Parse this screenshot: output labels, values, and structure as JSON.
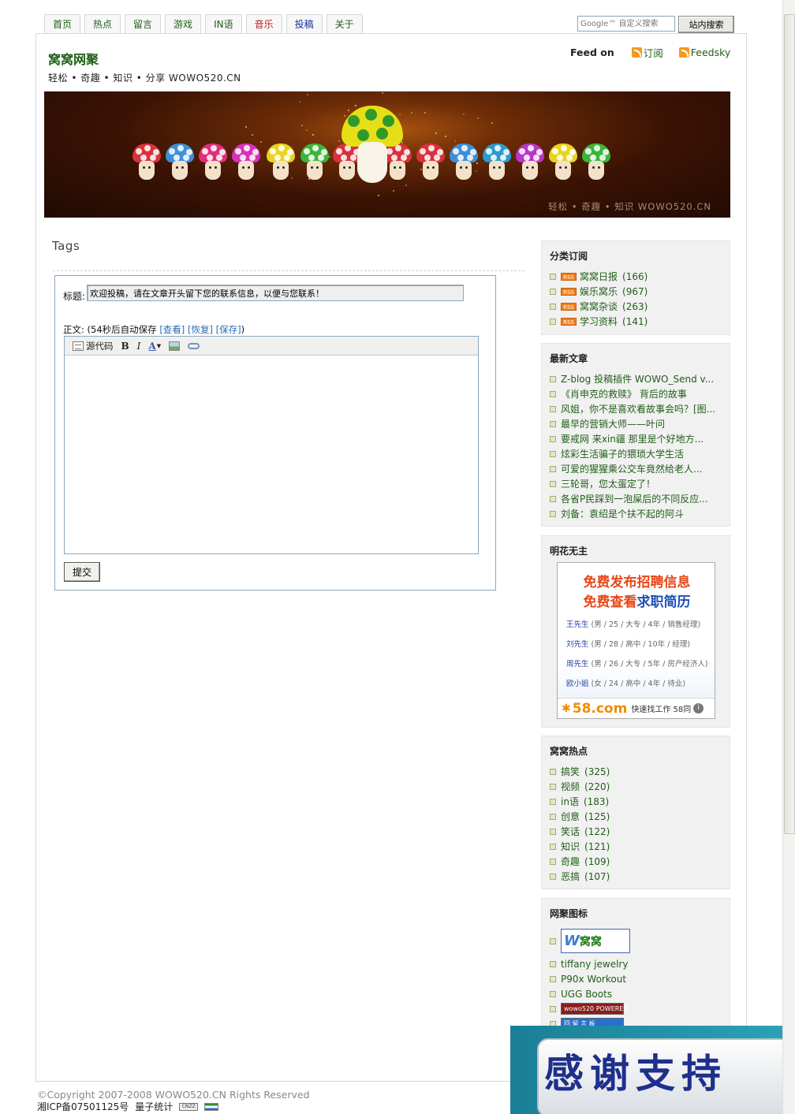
{
  "nav": {
    "tabs": [
      {
        "label": "首页",
        "style": "normal"
      },
      {
        "label": "热点",
        "style": "normal"
      },
      {
        "label": "留言",
        "style": "normal"
      },
      {
        "label": "游戏",
        "style": "normal"
      },
      {
        "label": "IN语",
        "style": "normal"
      },
      {
        "label": "音乐",
        "style": "red"
      },
      {
        "label": "投稿",
        "style": "blue"
      },
      {
        "label": "关于",
        "style": "normal"
      }
    ]
  },
  "search": {
    "placeholder": "Google™ 自定义搜索",
    "button_label": "站内搜索"
  },
  "header": {
    "title": "窝窝网聚",
    "subtitle": "轻松 • 奇趣 • 知识 • 分享 WOWO520.CN",
    "feed_label": "Feed on",
    "feed_links": [
      "订阅",
      "Feedsky"
    ]
  },
  "banner": {
    "text": "轻松 • 奇趣 • 知识 WOWO520.CN"
  },
  "main": {
    "heading": "Tags",
    "form": {
      "title_label": "标题:",
      "title_value": "欢迎投稿，请在文章开头留下您的联系信息，以便与您联系！",
      "body_label": "正文: (54秒后自动保存",
      "view_link": "[查看]",
      "restore_link": "[恢复]",
      "save_link": "[保存]",
      "close_paren": ")",
      "toolbar": {
        "source_label": "源代码",
        "bold": "B",
        "italic": "I",
        "font": "A"
      },
      "submit_label": "提交"
    }
  },
  "sidebar": {
    "category_feeds": {
      "title": "分类订阅",
      "badge": "RSS",
      "items": [
        {
          "label": "窝窝日报",
          "count": "(166)"
        },
        {
          "label": "娱乐窝乐",
          "count": "(967)"
        },
        {
          "label": "窝窝杂谈",
          "count": "(263)"
        },
        {
          "label": "学习资料",
          "count": "(141)"
        }
      ]
    },
    "latest_posts": {
      "title": "最新文章",
      "items": [
        "Z-blog 投稿插件 WOWO_Send v...",
        "《肖申克的救赎》 背后的故事",
        "风姐，你不是喜欢看故事会吗？[图...",
        "最早的营销大师——叶问",
        "要戒网 来xin疆 那里是个好地方...",
        "炫彩生活骗子的猥琐大学生活",
        "可爱的猩猩乘公交车竟然给老人...",
        "三轮哥，您太蛋定了！",
        "各省P民踩到一泡屎后的不同反应...",
        "刘备：袁绍是个扶不起的阿斗"
      ]
    },
    "ad_box": {
      "title": "明花无主",
      "line1": "免费发布招聘信息",
      "line2_pre": "免费查看",
      "line2_hl": "求职简历",
      "rows": [
        {
          "name": "王先生",
          "detail": "(男 / 25 / 大专 / 4年 / 销售经理)"
        },
        {
          "name": "刘先生",
          "detail": "(男 / 28 / 高中 / 10年 / 经理)"
        },
        {
          "name": "周先生",
          "detail": "(男 / 26 / 大专 / 5年 / 房产经济人)"
        },
        {
          "name": "欧小姐",
          "detail": "(女 / 24 / 高中 / 4年 / 待业)"
        }
      ],
      "logo": "58.com",
      "slogan": "快速找工作 58同",
      "info_icon": "i"
    },
    "hot_tags": {
      "title": "窝窝热点",
      "items": [
        {
          "label": "搞笑",
          "count": "(325)"
        },
        {
          "label": "视频",
          "count": "(220)"
        },
        {
          "label": "in语",
          "count": "(183)"
        },
        {
          "label": "创意",
          "count": "(125)"
        },
        {
          "label": "笑话",
          "count": "(122)"
        },
        {
          "label": "知识",
          "count": "(121)"
        },
        {
          "label": "奇趣",
          "count": "(109)"
        },
        {
          "label": "恶搞",
          "count": "(107)"
        }
      ]
    },
    "site_icons": {
      "title": "网聚图标",
      "wowo_badge_w": "W",
      "wowo_badge_text": "窝窝",
      "links": [
        "tiffany jewelry",
        "P90x Workout",
        "UGG Boots"
      ],
      "mini_badge_1": "wowo520 POWERED",
      "mini_badge_2": "回 留 言 板"
    }
  },
  "footer": {
    "copyright": "©Copyright 2007-2008 WOWO520.CN Rights Reserved",
    "icp": "湘ICP备07501125号",
    "stats": "量子统计",
    "cnzz": "CNZZ"
  },
  "overlay": {
    "text": "感谢支持"
  },
  "colors": {
    "link_green": "#1f5e16",
    "link_blue": "#2a6bb4",
    "ad_red": "#e84818",
    "ad_blue": "#1d4fb8",
    "rss_orange": "#f07d1a"
  }
}
